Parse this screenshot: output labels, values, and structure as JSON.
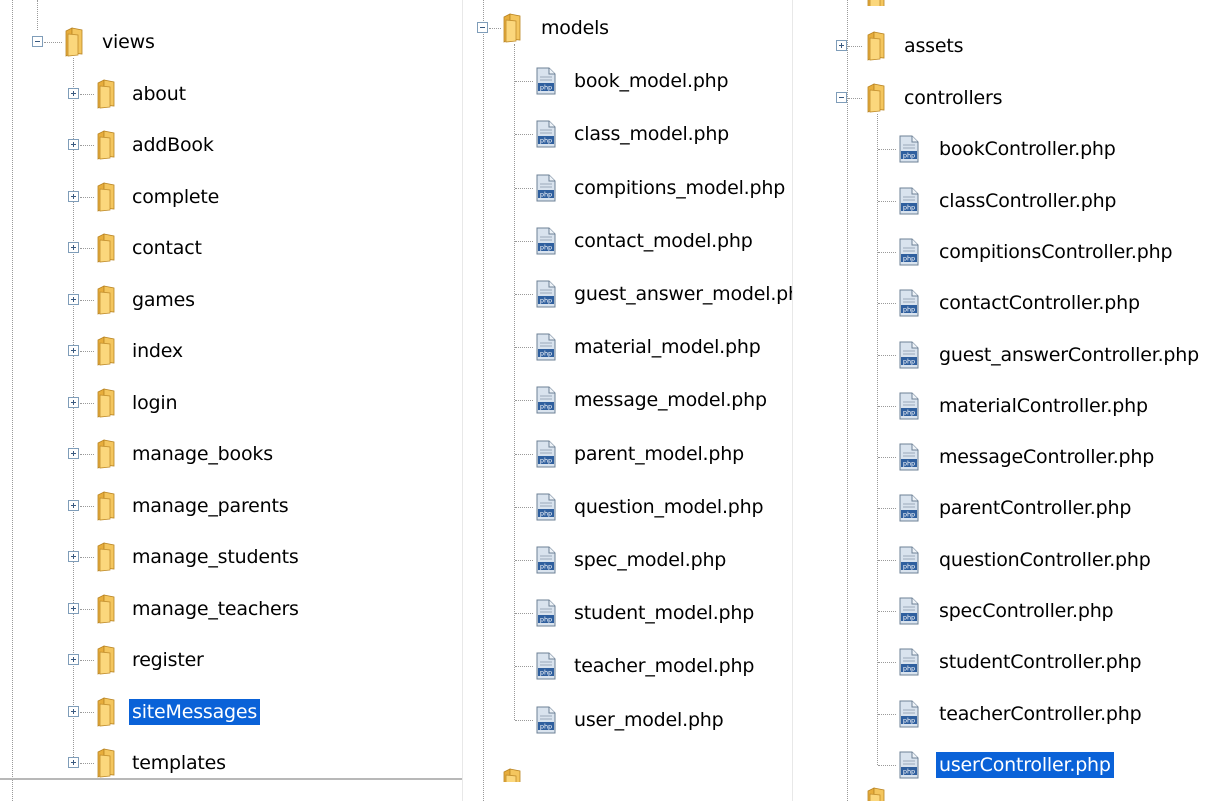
{
  "views_panel": {
    "root": "views",
    "items": [
      "about",
      "addBook",
      "complete",
      "contact",
      "games",
      "index",
      "login",
      "manage_books",
      "manage_parents",
      "manage_students",
      "manage_teachers",
      "register",
      "siteMessages",
      "templates"
    ],
    "selected": "siteMessages"
  },
  "models_panel": {
    "root": "models",
    "files": [
      "book_model.php",
      "class_model.php",
      "compitions_model.php",
      "contact_model.php",
      "guest_answer_model.php",
      "material_model.php",
      "message_model.php",
      "parent_model.php",
      "question_model.php",
      "spec_model.php",
      "student_model.php",
      "teacher_model.php",
      "user_model.php"
    ]
  },
  "controllers_panel": {
    "sibling_folder": "assets",
    "root": "controllers",
    "files": [
      "bookController.php",
      "classController.php",
      "compitionsController.php",
      "contactController.php",
      "guest_answerController.php",
      "materialController.php",
      "messageController.php",
      "parentController.php",
      "questionController.php",
      "specController.php",
      "studentController.php",
      "teacherController.php",
      "userController.php"
    ],
    "selected": "userController.php"
  },
  "icons": {
    "folder": "folder-icon",
    "php_file": "php-file-icon",
    "expand": "expand-plus-icon",
    "collapse": "collapse-minus-icon"
  },
  "colors": {
    "selection": "#0a62d8",
    "folder": "#f2c35a"
  }
}
